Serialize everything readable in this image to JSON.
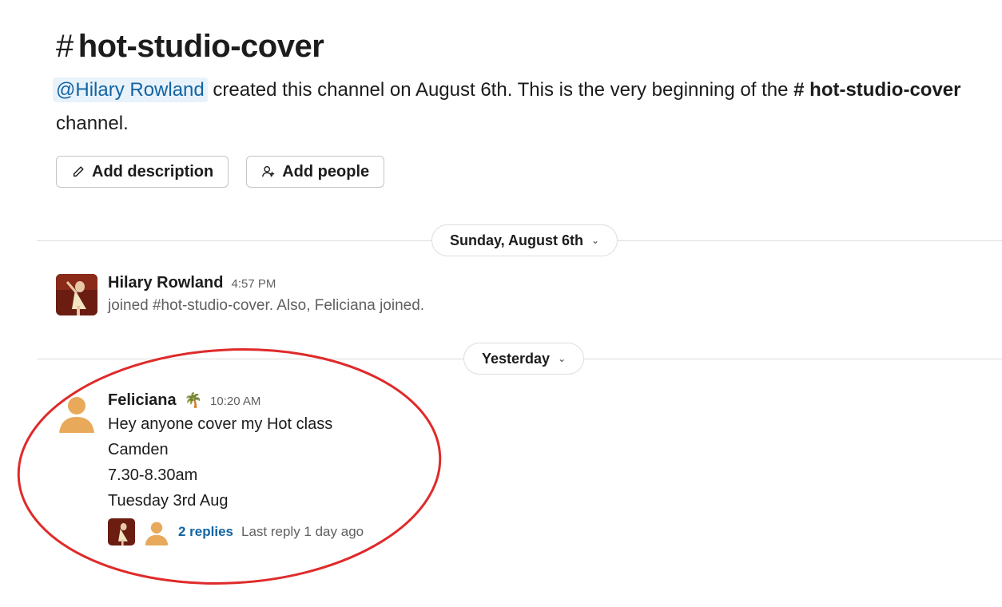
{
  "channel": {
    "hash": "#",
    "name": "hot-studio-cover",
    "intro_mention": "@Hilary Rowland",
    "intro_text_1": " created this channel on August 6th. This is the very beginning of the ",
    "intro_hash": "#",
    "intro_channel": " hot-studio-cover",
    "intro_text_2": " channel."
  },
  "actions": {
    "add_description": "Add description",
    "add_people": "Add people"
  },
  "dividers": {
    "first": "Sunday, August 6th",
    "second": "Yesterday",
    "chevron": "⌄"
  },
  "messages": [
    {
      "author": "Hilary Rowland",
      "time": "4:57 PM",
      "text": "joined #hot-studio-cover. Also, Feliciana joined."
    },
    {
      "author": "Feliciana",
      "status_emoji": "🌴",
      "time": "10:20 AM",
      "lines": [
        "Hey anyone cover my Hot class",
        "Camden",
        "7.30-8.30am",
        "Tuesday 3rd Aug"
      ],
      "replies_link": "2 replies",
      "last_reply": "Last reply 1 day ago"
    }
  ],
  "colors": {
    "accent_link": "#1264a3",
    "annotation": "#e02a2a",
    "default_avatar": "#e8a95b"
  },
  "icons": [
    "pencil-icon",
    "add-person-icon",
    "chevron-down-icon",
    "palm-tree-icon"
  ]
}
